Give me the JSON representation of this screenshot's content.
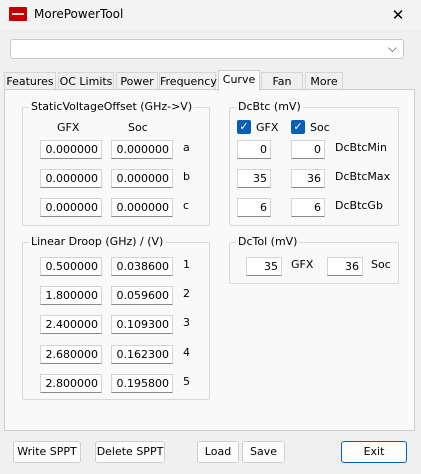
{
  "window": {
    "title": "MorePowerTool"
  },
  "combo": {
    "value": ""
  },
  "tabs": [
    "Features",
    "OC Limits",
    "Power",
    "Frequency",
    "Curve",
    "Fan",
    "More"
  ],
  "static_voltage_offset": {
    "title": "StaticVoltageOffset (GHz->V)",
    "col_gfx": "GFX",
    "col_soc": "Soc",
    "rows": [
      {
        "label": "a",
        "gfx": "0.000000",
        "soc": "0.000000"
      },
      {
        "label": "b",
        "gfx": "0.000000",
        "soc": "0.000000"
      },
      {
        "label": "c",
        "gfx": "0.000000",
        "soc": "0.000000"
      }
    ]
  },
  "linear_droop": {
    "title": "Linear Droop (GHz) / (V)",
    "rows": [
      {
        "label": "1",
        "ghz": "0.500000",
        "v": "0.038600"
      },
      {
        "label": "2",
        "ghz": "1.800000",
        "v": "0.059600"
      },
      {
        "label": "3",
        "ghz": "2.400000",
        "v": "0.109300"
      },
      {
        "label": "4",
        "ghz": "2.680000",
        "v": "0.162300"
      },
      {
        "label": "5",
        "ghz": "2.800000",
        "v": "0.195800"
      }
    ]
  },
  "dcbtc": {
    "title": "DcBtc (mV)",
    "gfx_checkbox": {
      "label": "GFX",
      "checked": true
    },
    "soc_checkbox": {
      "label": "Soc",
      "checked": true
    },
    "rows": [
      {
        "label": "DcBtcMin",
        "gfx": "0",
        "soc": "0"
      },
      {
        "label": "DcBtcMax",
        "gfx": "35",
        "soc": "36"
      },
      {
        "label": "DcBtcGb",
        "gfx": "6",
        "soc": "6"
      }
    ]
  },
  "dctol": {
    "title": "DcTol (mV)",
    "gfx_value": "35",
    "gfx_label": "GFX",
    "soc_value": "36",
    "soc_label": "Soc"
  },
  "buttons": {
    "write_sppt": "Write SPPT",
    "delete_sppt": "Delete SPPT",
    "load": "Load",
    "save": "Save",
    "exit": "Exit"
  },
  "icons": {
    "close": "close-icon",
    "dropdown": "chevron-down-icon",
    "check": "checkmark-icon",
    "app": "app-icon"
  },
  "colors": {
    "accent": "#0a5fb5",
    "app_icon": "#c00000"
  }
}
